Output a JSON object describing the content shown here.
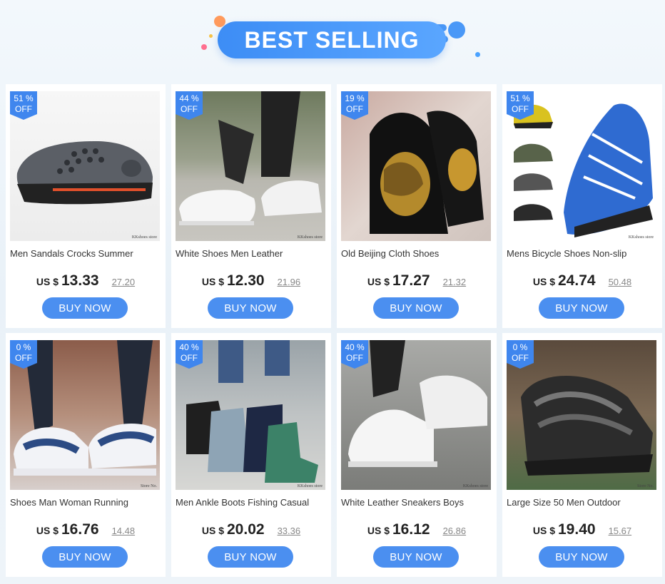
{
  "header": {
    "title": "BEST SELLING"
  },
  "button_label": "BUY NOW",
  "currency": "US $",
  "products": [
    {
      "discount": "51 %",
      "off": "OFF",
      "title": "Men Sandals Crocks Summer",
      "price": "13.33",
      "old_price": "27.20",
      "store_tag": "KKshoes store"
    },
    {
      "discount": "44 %",
      "off": "OFF",
      "title": "White Shoes Men Leather",
      "price": "12.30",
      "old_price": "21.96",
      "store_tag": "KKshoes store"
    },
    {
      "discount": "19 %",
      "off": "OFF",
      "title": "Old Beijing Cloth Shoes",
      "price": "17.27",
      "old_price": "21.32",
      "store_tag": "KKshoes store"
    },
    {
      "discount": "51 %",
      "off": "OFF",
      "title": "Mens Bicycle Shoes Non-slip",
      "price": "24.74",
      "old_price": "50.48",
      "store_tag": "KKshoes store"
    },
    {
      "discount": "0 %",
      "off": "OFF",
      "title": "Shoes Man Woman Running",
      "price": "16.76",
      "old_price": "14.48",
      "store_tag": "Store No."
    },
    {
      "discount": "40 %",
      "off": "OFF",
      "title": "Men Ankle Boots Fishing Casual",
      "price": "20.02",
      "old_price": "33.36",
      "store_tag": "KKshoes store"
    },
    {
      "discount": "40 %",
      "off": "OFF",
      "title": "White Leather Sneakers Boys",
      "price": "16.12",
      "old_price": "26.86",
      "store_tag": "KKshoes store"
    },
    {
      "discount": "0 %",
      "off": "OFF",
      "title": "Large Size 50 Men Outdoor",
      "price": "19.40",
      "old_price": "15.67",
      "store_tag": "Store No."
    }
  ]
}
